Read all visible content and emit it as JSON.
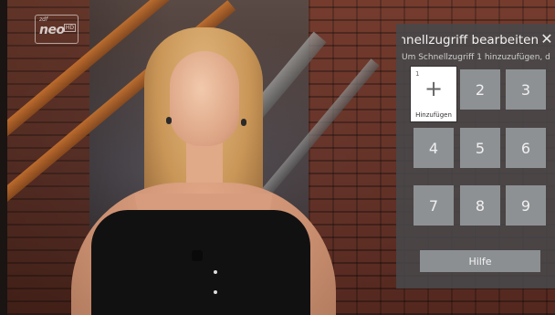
{
  "channel": {
    "brand": "zdf",
    "name": "neo",
    "quality": "HD"
  },
  "quick_access": {
    "title": "Schnellzugriff bearbeiten",
    "subtitle": "Um Schnellzugriff 1 hinzuzufügen, d",
    "close_icon": "close-icon",
    "focused_key": {
      "number": "1",
      "icon": "plus-icon",
      "glyph": "+",
      "label": "Hinzufügen"
    },
    "keys": [
      "2",
      "3",
      "4",
      "5",
      "6",
      "7",
      "8",
      "9"
    ],
    "help_label": "Hilfe"
  }
}
